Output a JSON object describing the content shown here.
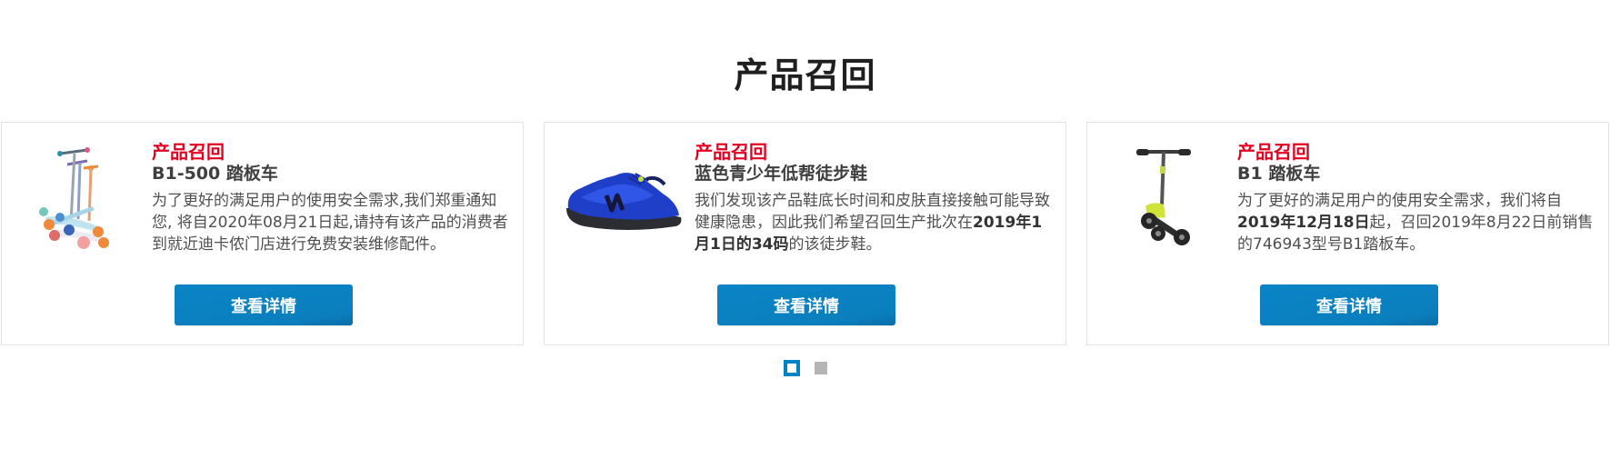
{
  "section": {
    "title": "产品召回"
  },
  "cards": [
    {
      "image": "kids-scooter-image",
      "tag": "产品召回",
      "name": "B1-500 踏板车",
      "desc_html": "为了更好的满足用户的使用安全需求,我们郑重通知您, 将自2020年08月21日起,请持有该产品的消费者到就近迪卡侬门店进行免费安装维修配件。",
      "button": "查看详情"
    },
    {
      "image": "blue-hiking-shoe-image",
      "tag": "产品召回",
      "name": "蓝色青少年低帮徒步鞋",
      "desc_parts": [
        "我们发现该产品鞋底长时间和皮肤直接接触可能导致健康隐患，因此我们希望召回生产批次在",
        "2019年1月1日的34码",
        "的该徒步鞋。"
      ],
      "button": "查看详情"
    },
    {
      "image": "b1-scooter-image",
      "tag": "产品召回",
      "name": "B1 踏板车",
      "desc_parts": [
        "为了更好的满足用户的使用安全需求，我们将自",
        "2019年12月18日",
        "起，召回2019年8月22日前销售的746943型号B1踏板车。"
      ],
      "button": "查看详情"
    }
  ],
  "pager": {
    "total": 2,
    "active_index": 0
  },
  "colors": {
    "accent": "#0082c3",
    "tag_red": "#e1001f",
    "title": "#1f1f1f"
  }
}
